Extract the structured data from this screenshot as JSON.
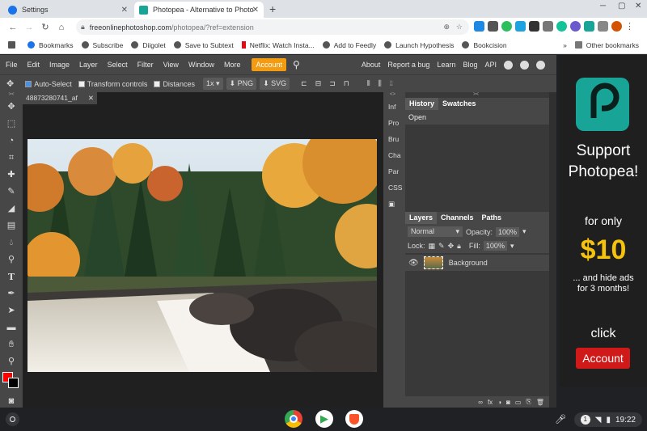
{
  "browser": {
    "tabs": [
      {
        "title": "Settings",
        "active": false
      },
      {
        "title": "Photopea - Alternative to Photos",
        "active": true
      }
    ],
    "url_host": "freeonlinephotoshop.com",
    "url_path": "/photopea/?ref=extension",
    "bookmarks": [
      "Bookmarks",
      "Subscribe",
      "Diigolet",
      "Save to Subtext",
      "Netflix: Watch Insta...",
      "Add to Feedly",
      "Launch Hypothesis",
      "Bookcision"
    ],
    "other_bookmarks": "Other bookmarks",
    "overflow": "»"
  },
  "photopea": {
    "menu": [
      "File",
      "Edit",
      "Image",
      "Layer",
      "Select",
      "Filter",
      "View",
      "Window",
      "More"
    ],
    "account_button": "Account",
    "menu_right": [
      "About",
      "Report a bug",
      "Learn",
      "Blog",
      "API"
    ],
    "toolbar_options": {
      "auto_select": "Auto-Select",
      "transform_controls": "Transform controls",
      "distances": "Distances",
      "zoom": "1x",
      "export_png": "PNG",
      "export_svg": "SVG"
    },
    "document_tab": "48873280741_af",
    "side_tabs": [
      "Inf",
      "Pro",
      "Bru",
      "Cha",
      "Par",
      "CSS"
    ],
    "history_panel": {
      "tabs": [
        "History",
        "Swatches"
      ],
      "items": [
        "Open"
      ]
    },
    "layers_panel": {
      "tabs": [
        "Layers",
        "Channels",
        "Paths"
      ],
      "blend_mode": "Normal",
      "opacity_label": "Opacity:",
      "opacity_value": "100%",
      "lock_label": "Lock:",
      "fill_label": "Fill:",
      "fill_value": "100%",
      "layers": [
        {
          "name": "Background"
        }
      ]
    }
  },
  "ad": {
    "line1": "Support",
    "line2": "Photopea!",
    "line3": "for only",
    "price": "$10",
    "line4": "... and hide ads",
    "line5": "for 3 months!",
    "click": "click",
    "account": "Account"
  },
  "shelf": {
    "notification_count": "1",
    "time": "19:22"
  },
  "colors": {
    "accent": "#f39c12",
    "foreground_color": "#ff0000",
    "ad_red": "#d01a1a",
    "photopea_teal": "#18a497"
  }
}
